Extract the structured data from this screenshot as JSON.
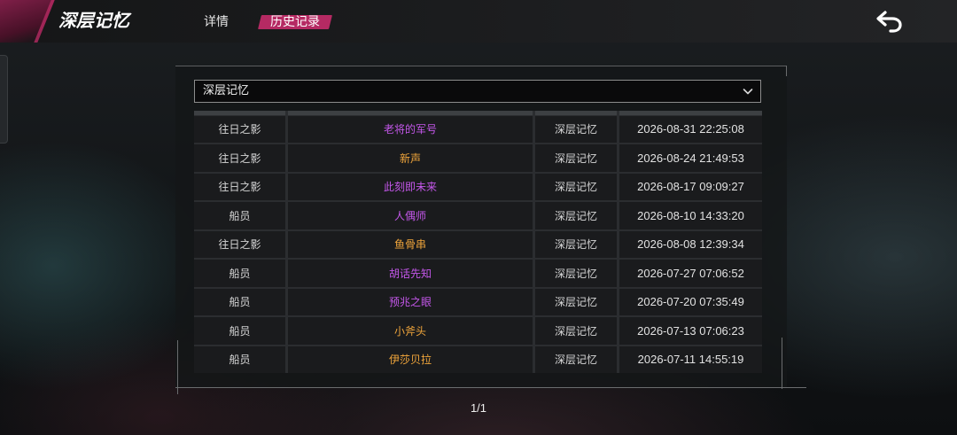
{
  "header": {
    "title": "深层记忆",
    "tabs": [
      {
        "label": "详情",
        "active": false
      },
      {
        "label": "历史记录",
        "active": true
      }
    ],
    "back_icon": "back-arrow-icon"
  },
  "filter": {
    "selected": "深层记忆",
    "icon": "chevron-down-icon"
  },
  "history": {
    "rows": [
      {
        "type": "往日之影",
        "name": "老将的军号",
        "name_color": "#c457ea",
        "pool": "深层记忆",
        "time": "2026-08-31 22:25:08"
      },
      {
        "type": "往日之影",
        "name": "新声",
        "name_color": "#f0a53b",
        "pool": "深层记忆",
        "time": "2026-08-24 21:49:53"
      },
      {
        "type": "往日之影",
        "name": "此刻即未来",
        "name_color": "#c457ea",
        "pool": "深层记忆",
        "time": "2026-08-17 09:09:27"
      },
      {
        "type": "船员",
        "name": "人偶师",
        "name_color": "#c457ea",
        "pool": "深层记忆",
        "time": "2026-08-10 14:33:20"
      },
      {
        "type": "往日之影",
        "name": "鱼骨串",
        "name_color": "#f0a53b",
        "pool": "深层记忆",
        "time": "2026-08-08 12:39:34"
      },
      {
        "type": "船员",
        "name": "胡话先知",
        "name_color": "#c457ea",
        "pool": "深层记忆",
        "time": "2026-07-27 07:06:52"
      },
      {
        "type": "船员",
        "name": "预兆之眼",
        "name_color": "#c457ea",
        "pool": "深层记忆",
        "time": "2026-07-20 07:35:49"
      },
      {
        "type": "船员",
        "name": "小斧头",
        "name_color": "#f0a53b",
        "pool": "深层记忆",
        "time": "2026-07-13 07:06:23"
      },
      {
        "type": "船员",
        "name": "伊莎贝拉",
        "name_color": "#f0a53b",
        "pool": "深层记忆",
        "time": "2026-07-11 14:55:19"
      }
    ]
  },
  "pagination": {
    "label": "1/1"
  },
  "colors": {
    "accent": "#b52a63",
    "title_stripe": "#8f2150",
    "panel_line": "#6a6c6e",
    "rarity_purple": "#c457ea",
    "rarity_gold": "#f0a53b"
  }
}
